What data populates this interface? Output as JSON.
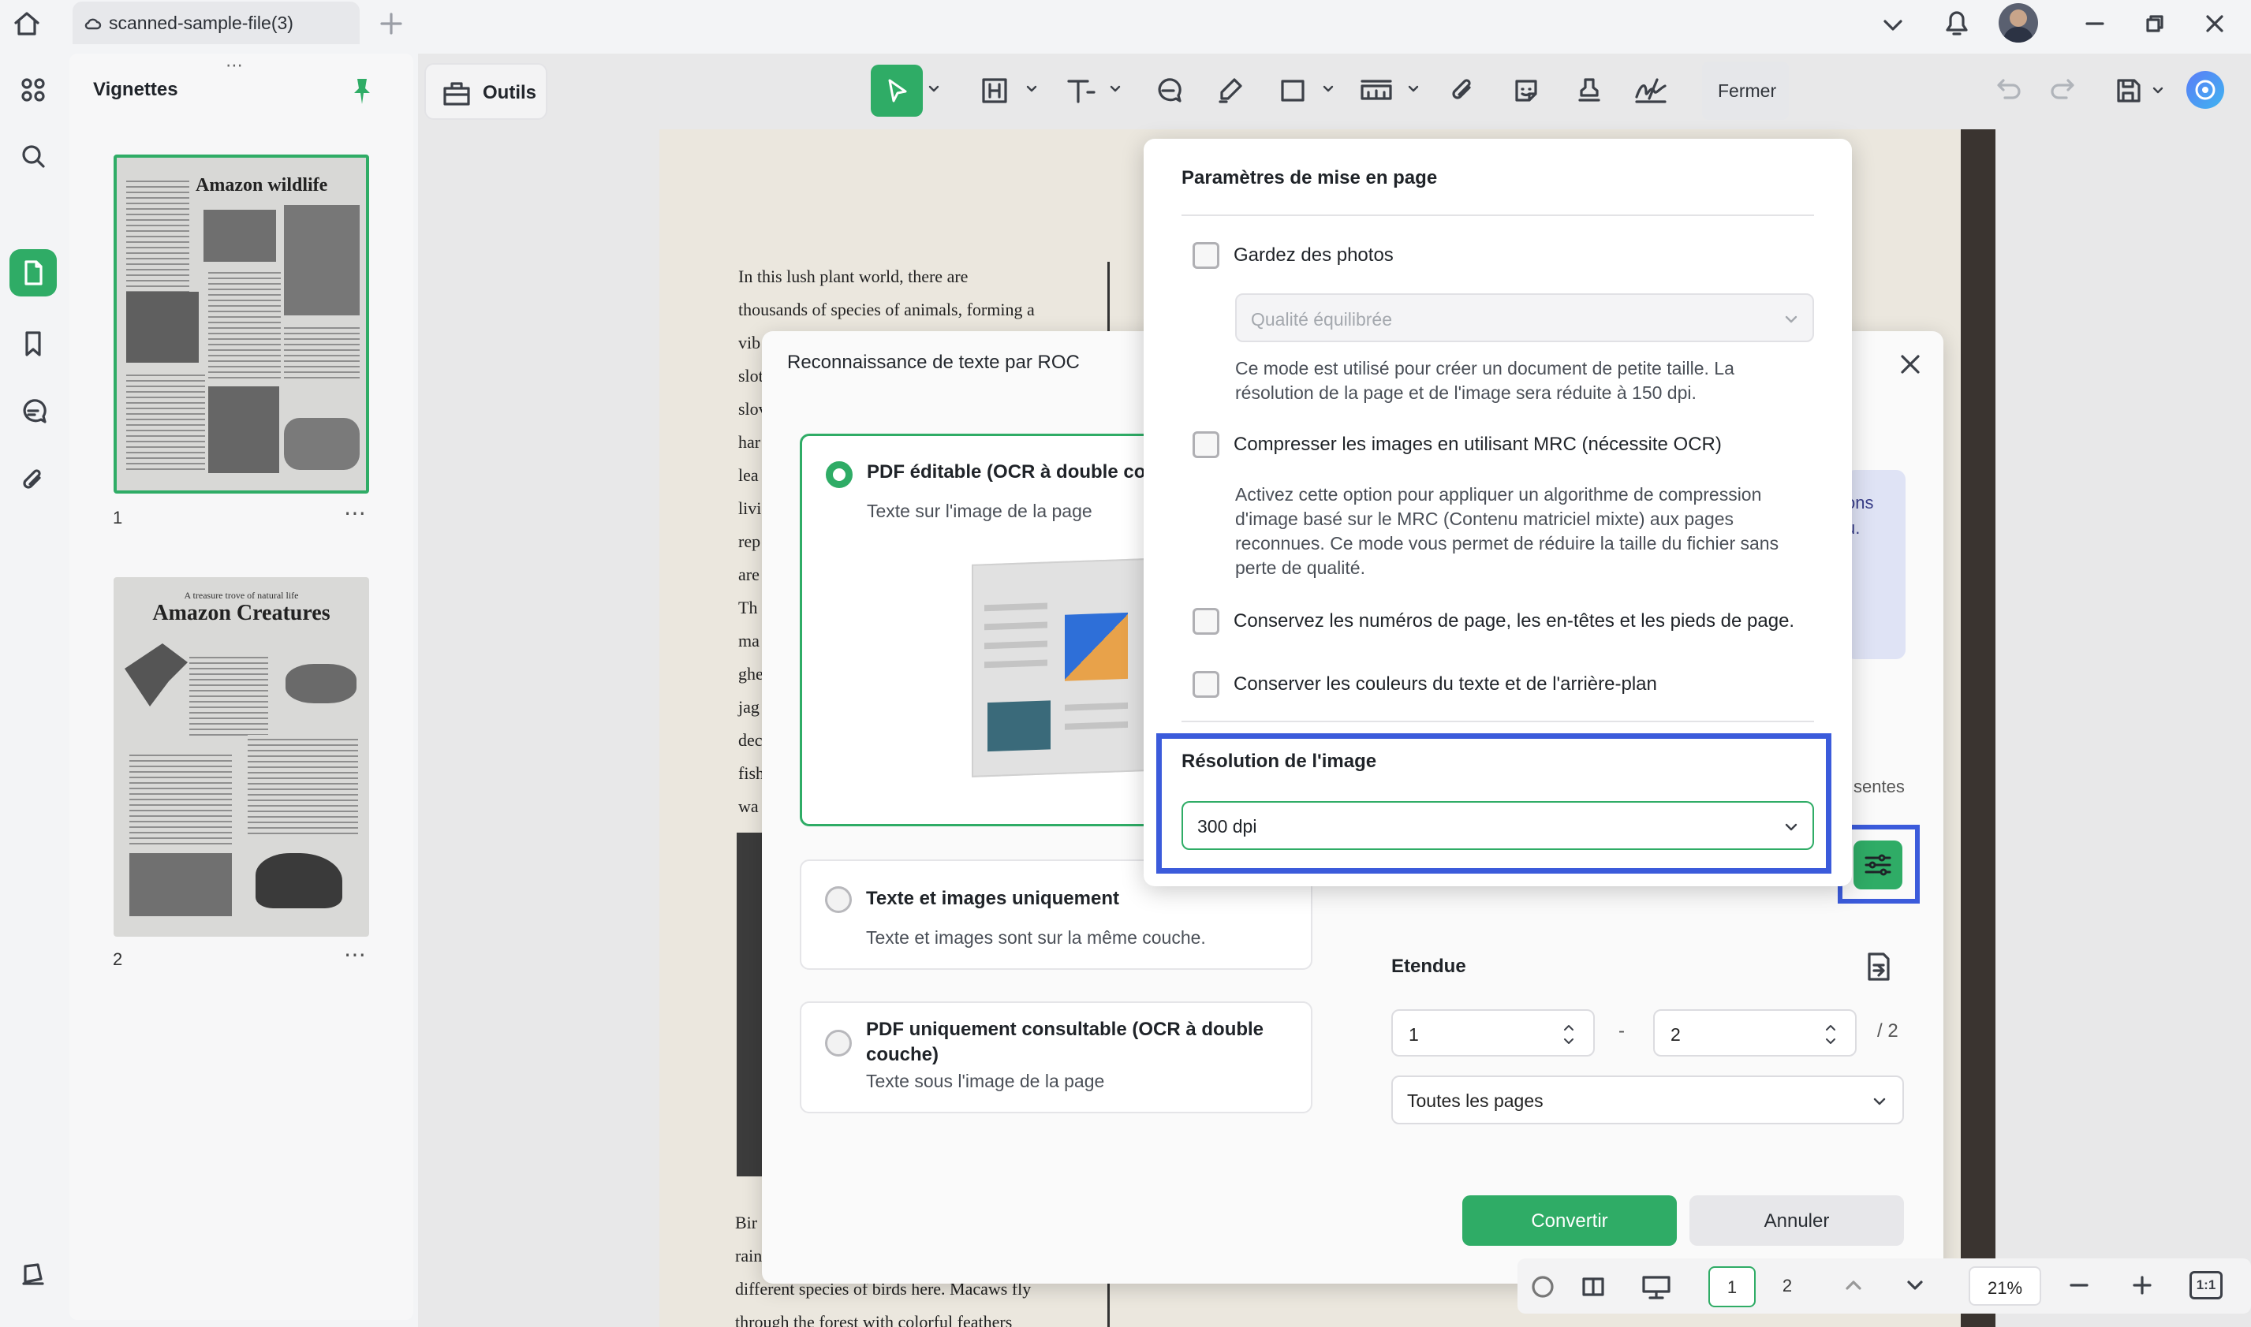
{
  "window": {
    "tab_title": "scanned-sample-file(3)",
    "icons": {
      "home": "home-icon",
      "new_tab": "plus-icon",
      "chevron": "chevron-down-icon",
      "bell": "bell-icon",
      "avatar": "avatar"
    }
  },
  "sidebar": {
    "title": "Vignettes",
    "pages": [
      {
        "number": "1",
        "heading": "Amazon wildlife"
      },
      {
        "number": "2",
        "kicker": "A treasure trove of natural life",
        "heading": "Amazon Creatures"
      }
    ]
  },
  "toolbar": {
    "outils_label": "Outils",
    "fermer_label": "Fermer"
  },
  "document": {
    "lines": [
      "In this lush plant world, there are",
      "thousands of species of animals, forming a"
    ],
    "fragments": [
      "vib",
      "slot",
      "slov",
      "har",
      "lea",
      "livi",
      "rep",
      "are",
      "Th",
      "ma",
      "ghe",
      "jag",
      "dec",
      "fish",
      "wa"
    ],
    "bottom_lines": [
      "Bir",
      "rain",
      "different species of birds here. Macaws fly",
      "through the forest with colorful feathers"
    ]
  },
  "ocr_dialog": {
    "title": "Reconnaissance de texte par ROC",
    "options": [
      {
        "title": "PDF éditable (OCR à double couc",
        "desc": "Texte sur l'image de la page",
        "selected": true
      },
      {
        "title": "Texte et images uniquement",
        "desc": "Texte et images sont sur la même couche.",
        "selected": false
      },
      {
        "title": "PDF uniquement consultable (OCR à double couche)",
        "desc": "Texte sous l'image de la page",
        "selected": false
      }
    ],
    "info_fragment": "ons\nu.",
    "sentes_fragment": "sentes",
    "range_label": "Etendue",
    "range_from": "1",
    "range_to": "2",
    "range_dash": "-",
    "range_total": "/ 2",
    "pages_select": "Toutes les pages",
    "convert_label": "Convertir",
    "cancel_label": "Annuler"
  },
  "layout_settings": {
    "title": "Paramètres de mise en page",
    "keep_photos": {
      "label": "Gardez des photos",
      "checked": false
    },
    "quality_placeholder": "Qualité équilibrée",
    "quality_desc": "Ce mode est utilisé pour créer un document de petite taille. La résolution de la page et de l'image sera réduite à 150 dpi.",
    "mrc": {
      "label": "Compresser les images en utilisant MRC (nécessite OCR)",
      "checked": false
    },
    "mrc_desc": "Activez cette option pour appliquer un algorithme de compression d'image basé sur le MRC (Contenu matriciel mixte) aux pages reconnues. Ce mode vous permet de réduire la taille du fichier sans perte de qualité.",
    "keep_headers": {
      "label": "Conservez les numéros de page, les en-têtes et les pieds de page.",
      "checked": false
    },
    "keep_colors": {
      "label": "Conserver les couleurs du texte et de l'arrière-plan",
      "checked": false
    },
    "resolution_label": "Résolution de l'image",
    "resolution_value": "300 dpi"
  },
  "statusbar": {
    "page_current": "1",
    "page_next": "2",
    "zoom": "21%",
    "fit_label": "1:1"
  },
  "colors": {
    "accent": "#2fac66",
    "highlight": "#3b5bdb"
  }
}
